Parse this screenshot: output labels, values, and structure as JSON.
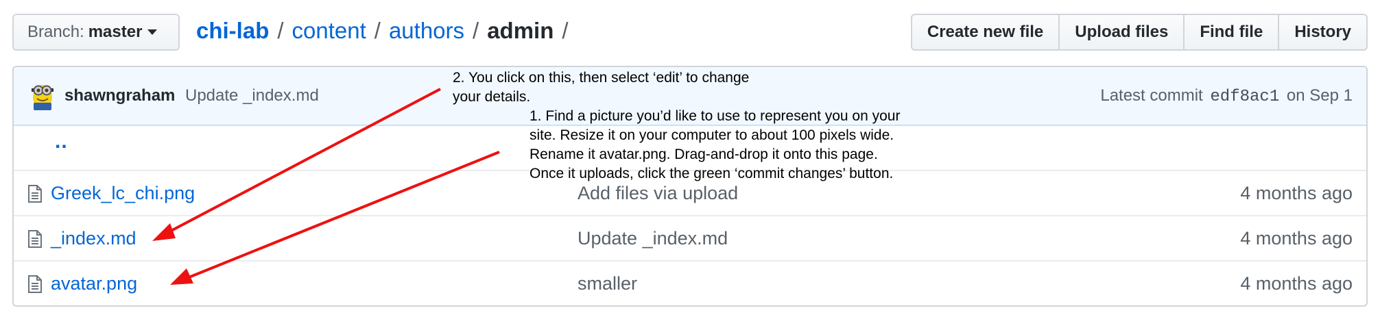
{
  "branch": {
    "label": "Branch:",
    "value": "master"
  },
  "breadcrumb": {
    "repo": "chi-lab",
    "sep": "/",
    "dir1": "content",
    "dir2": "authors",
    "current": "admin"
  },
  "actions": {
    "create": "Create new file",
    "upload": "Upload files",
    "find": "Find file",
    "history": "History"
  },
  "commit": {
    "author": "shawngraham",
    "message": "Update _index.md",
    "latest_label": "Latest commit",
    "sha": "edf8ac1",
    "date": "on Sep 1"
  },
  "parent_link": "..",
  "files": [
    {
      "name": "Greek_lc_chi.png",
      "message": "Add files via upload",
      "age": "4 months ago"
    },
    {
      "name": "_index.md",
      "message": "Update _index.md",
      "age": "4 months ago"
    },
    {
      "name": "avatar.png",
      "message": "smaller",
      "age": "4 months ago"
    }
  ],
  "annotations": {
    "note2": [
      "2. You click on this, then select ‘edit’ to change",
      "your details."
    ],
    "note1": [
      "1. Find a picture you’d like to use to represent you on your",
      "site. Resize it on your computer to about 100 pixels wide.",
      "Rename it avatar.png. Drag-and-drop it onto this page.",
      "Once it uploads, click the green ‘commit changes’ button."
    ],
    "arrow_color": "#ee1111"
  },
  "colors": {
    "link": "#0366d6",
    "muted": "#586069",
    "commit_bg": "#f1f8ff",
    "border": "#d1d5da"
  }
}
